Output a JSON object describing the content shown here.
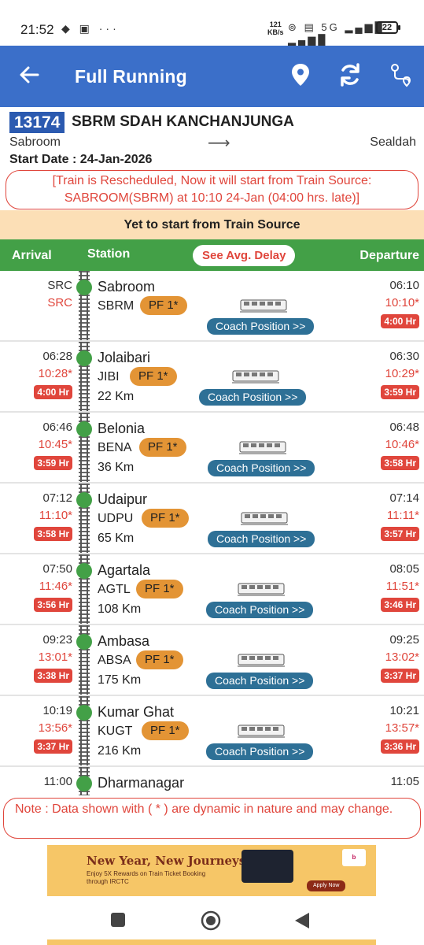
{
  "status_bar": {
    "time": "21:52",
    "net_speed": "121",
    "net_unit": "KB/s",
    "battery": "22"
  },
  "app_bar": {
    "title": "Full Running"
  },
  "train": {
    "number": "13174",
    "name": "SBRM SDAH KANCHANJUNGA",
    "source": "Sabroom",
    "destination": "Sealdah",
    "start_date": "Start Date : 24-Jan-2026"
  },
  "reschedule_notice": "[Train is Rescheduled, Now it will start from Train Source: SABROOM(SBRM) at 10:10 24-Jan (04:00 hrs. late)]",
  "status_banner": "Yet to start from Train Source",
  "columns": {
    "arrival": "Arrival",
    "station": "Station",
    "avg_delay": "See Avg. Delay",
    "departure": "Departure"
  },
  "coach_button_label": "Coach Position >>",
  "stations": [
    {
      "arr_sched": "SRC",
      "arr_act": "SRC",
      "arr_delay": "",
      "name": "Sabroom",
      "code": "SBRM",
      "pf": "PF 1*",
      "km": "",
      "dep_sched": "06:10",
      "dep_act": "10:10*",
      "dep_delay": "4:00 Hr"
    },
    {
      "arr_sched": "06:28",
      "arr_act": "10:28*",
      "arr_delay": "4:00 Hr",
      "name": "Jolaibari",
      "code": "JIBI",
      "pf": "PF 1*",
      "km": "22 Km",
      "dep_sched": "06:30",
      "dep_act": "10:29*",
      "dep_delay": "3:59 Hr"
    },
    {
      "arr_sched": "06:46",
      "arr_act": "10:45*",
      "arr_delay": "3:59 Hr",
      "name": "Belonia",
      "code": "BENA",
      "pf": "PF 1*",
      "km": "36 Km",
      "dep_sched": "06:48",
      "dep_act": "10:46*",
      "dep_delay": "3:58 Hr"
    },
    {
      "arr_sched": "07:12",
      "arr_act": "11:10*",
      "arr_delay": "3:58 Hr",
      "name": "Udaipur",
      "code": "UDPU",
      "pf": "PF 1*",
      "km": "65 Km",
      "dep_sched": "07:14",
      "dep_act": "11:11*",
      "dep_delay": "3:57 Hr"
    },
    {
      "arr_sched": "07:50",
      "arr_act": "11:46*",
      "arr_delay": "3:56 Hr",
      "name": "Agartala",
      "code": "AGTL",
      "pf": "PF 1*",
      "km": "108 Km",
      "dep_sched": "08:05",
      "dep_act": "11:51*",
      "dep_delay": "3:46 Hr"
    },
    {
      "arr_sched": "09:23",
      "arr_act": "13:01*",
      "arr_delay": "3:38 Hr",
      "name": "Ambasa",
      "code": "ABSA",
      "pf": "PF 1*",
      "km": "175 Km",
      "dep_sched": "09:25",
      "dep_act": "13:02*",
      "dep_delay": "3:37 Hr"
    },
    {
      "arr_sched": "10:19",
      "arr_act": "13:56*",
      "arr_delay": "3:37 Hr",
      "name": "Kumar Ghat",
      "code": "KUGT",
      "pf": "PF 1*",
      "km": "216 Km",
      "dep_sched": "10:21",
      "dep_act": "13:57*",
      "dep_delay": "3:36 Hr"
    },
    {
      "arr_sched": "11:00",
      "arr_act": "",
      "arr_delay": "",
      "name": "Dharmanagar",
      "code": "",
      "pf": "",
      "km": "",
      "dep_sched": "11:05",
      "dep_act": "",
      "dep_delay": ""
    }
  ],
  "note": "Note : Data shown with ( * ) are dynamic in nature and may change.",
  "ad": {
    "title": "New Year, New Journeys!",
    "line1": "Enjoy 5X Rewards on Train Ticket Booking",
    "line2": "through IRCTC",
    "apply": "Apply Now"
  },
  "colors": {
    "app_bar": "#3b6fc9",
    "green": "#43a047",
    "red": "#e0463c",
    "platform": "#e39435",
    "coach_button": "#2e7096",
    "banner": "#fcdfb6"
  }
}
